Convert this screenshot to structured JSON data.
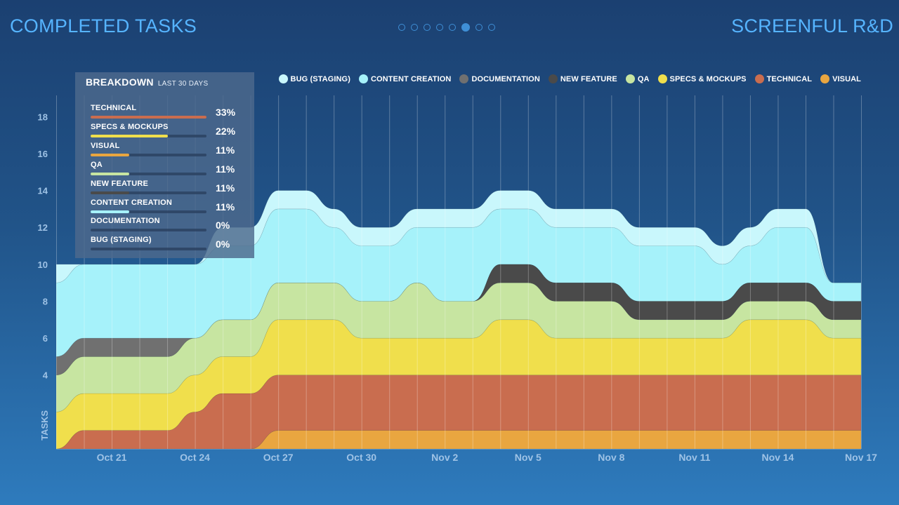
{
  "header": {
    "left_title": "COMPLETED TASKS",
    "right_title": "SCREENFUL R&D",
    "pager_count": 8,
    "pager_active": 5
  },
  "colors": {
    "accent": "#56b4ff",
    "technical": "#c96d4f",
    "specs_mockups": "#f0df4c",
    "visual": "#e9a640",
    "qa": "#c7e5a1",
    "new_feature": "#4a4a4a",
    "content_creation": "#a6f2fa",
    "documentation": "#707070",
    "bug_staging": "#c9f7fc"
  },
  "breakdown": {
    "title": "BREAKDOWN",
    "subtitle": "LAST 30 DAYS",
    "rows": [
      {
        "label": "TECHNICAL",
        "pct": "33%",
        "value": 33,
        "color": "#c96d4f"
      },
      {
        "label": "SPECS & MOCKUPS",
        "pct": "22%",
        "value": 22,
        "color": "#f0df4c"
      },
      {
        "label": "VISUAL",
        "pct": "11%",
        "value": 11,
        "color": "#e9a640"
      },
      {
        "label": "QA",
        "pct": "11%",
        "value": 11,
        "color": "#c7e5a1"
      },
      {
        "label": "NEW FEATURE",
        "pct": "11%",
        "value": 11,
        "color": "#4a4a4a"
      },
      {
        "label": "CONTENT CREATION",
        "pct": "11%",
        "value": 11,
        "color": "#a6f2fa"
      },
      {
        "label": "DOCUMENTATION",
        "pct": "0%",
        "value": 0,
        "color": "#707070"
      },
      {
        "label": "BUG (STAGING)",
        "pct": "0%",
        "value": 0,
        "color": "#c9f7fc"
      }
    ]
  },
  "chart_data": {
    "type": "area",
    "stacked": true,
    "ylabel": "TASKS",
    "ylim": [
      0,
      19
    ],
    "yticks": [
      4,
      6,
      8,
      10,
      12,
      14,
      16,
      18
    ],
    "xlim": [
      0,
      29
    ],
    "xticks": [
      {
        "x": 2,
        "label": "Oct 21"
      },
      {
        "x": 5,
        "label": "Oct 24"
      },
      {
        "x": 8,
        "label": "Oct 27"
      },
      {
        "x": 11,
        "label": "Oct 30"
      },
      {
        "x": 14,
        "label": "Nov 2"
      },
      {
        "x": 17,
        "label": "Nov 5"
      },
      {
        "x": 20,
        "label": "Nov 8"
      },
      {
        "x": 23,
        "label": "Nov 11"
      },
      {
        "x": 26,
        "label": "Nov 14"
      },
      {
        "x": 29,
        "label": "Nov 17"
      }
    ],
    "grid": "vertical",
    "legend": "top-right",
    "x": [
      0,
      1,
      2,
      3,
      4,
      5,
      6,
      7,
      8,
      9,
      10,
      11,
      12,
      13,
      14,
      15,
      16,
      17,
      18,
      19,
      20,
      21,
      22,
      23,
      24,
      25,
      26,
      27,
      28,
      29
    ],
    "series": [
      {
        "name": "VISUAL",
        "color": "#e9a640",
        "values": [
          0,
          0,
          0,
          0,
          0,
          0,
          0,
          0,
          1,
          1,
          1,
          1,
          1,
          1,
          1,
          1,
          1,
          1,
          1,
          1,
          1,
          1,
          1,
          1,
          1,
          1,
          1,
          1,
          1,
          1
        ]
      },
      {
        "name": "TECHNICAL",
        "color": "#c96d4f",
        "values": [
          0,
          1,
          1,
          1,
          1,
          2,
          3,
          3,
          3,
          3,
          3,
          3,
          3,
          3,
          3,
          3,
          3,
          3,
          3,
          3,
          3,
          3,
          3,
          3,
          3,
          3,
          3,
          3,
          3,
          3
        ]
      },
      {
        "name": "SPECS & MOCKUPS",
        "color": "#f0df4c",
        "values": [
          2,
          2,
          2,
          2,
          2,
          2,
          2,
          2,
          3,
          3,
          3,
          2,
          2,
          2,
          2,
          2,
          3,
          3,
          2,
          2,
          2,
          2,
          2,
          2,
          2,
          3,
          3,
          3,
          2,
          2
        ]
      },
      {
        "name": "QA",
        "color": "#c7e5a1",
        "values": [
          2,
          2,
          2,
          2,
          2,
          2,
          2,
          2,
          2,
          2,
          2,
          2,
          2,
          3,
          2,
          2,
          2,
          2,
          2,
          2,
          2,
          1,
          1,
          1,
          1,
          1,
          1,
          1,
          1,
          1
        ]
      },
      {
        "name": "NEW FEATURE",
        "color": "#4a4a4a",
        "values": [
          0,
          0,
          0,
          0,
          0,
          0,
          0,
          0,
          0,
          0,
          0,
          0,
          0,
          0,
          0,
          0,
          1,
          1,
          1,
          1,
          1,
          1,
          1,
          1,
          1,
          1,
          1,
          1,
          1,
          1
        ]
      },
      {
        "name": "DOCUMENTATION",
        "color": "#707070",
        "values": [
          1,
          1,
          1,
          1,
          1,
          0,
          0,
          0,
          0,
          0,
          0,
          0,
          0,
          0,
          0,
          0,
          0,
          0,
          0,
          0,
          0,
          0,
          0,
          0,
          0,
          0,
          0,
          0,
          0,
          0
        ]
      },
      {
        "name": "CONTENT CREATION",
        "color": "#a6f2fa",
        "values": [
          4,
          4,
          4,
          4,
          4,
          4,
          4,
          4,
          4,
          4,
          3,
          3,
          3,
          3,
          4,
          4,
          3,
          3,
          3,
          3,
          3,
          3,
          3,
          3,
          2,
          2,
          3,
          3,
          1,
          1
        ]
      },
      {
        "name": "BUG (STAGING)",
        "color": "#c9f7fc",
        "values": [
          1,
          0,
          0,
          0,
          0,
          0,
          1,
          1,
          1,
          1,
          1,
          1,
          1,
          1,
          1,
          1,
          1,
          1,
          1,
          1,
          1,
          1,
          1,
          1,
          1,
          1,
          1,
          1,
          0,
          0
        ]
      }
    ],
    "legend_order": [
      "BUG (STAGING)",
      "CONTENT CREATION",
      "DOCUMENTATION",
      "NEW FEATURE",
      "QA",
      "SPECS & MOCKUPS",
      "TECHNICAL",
      "VISUAL"
    ]
  }
}
